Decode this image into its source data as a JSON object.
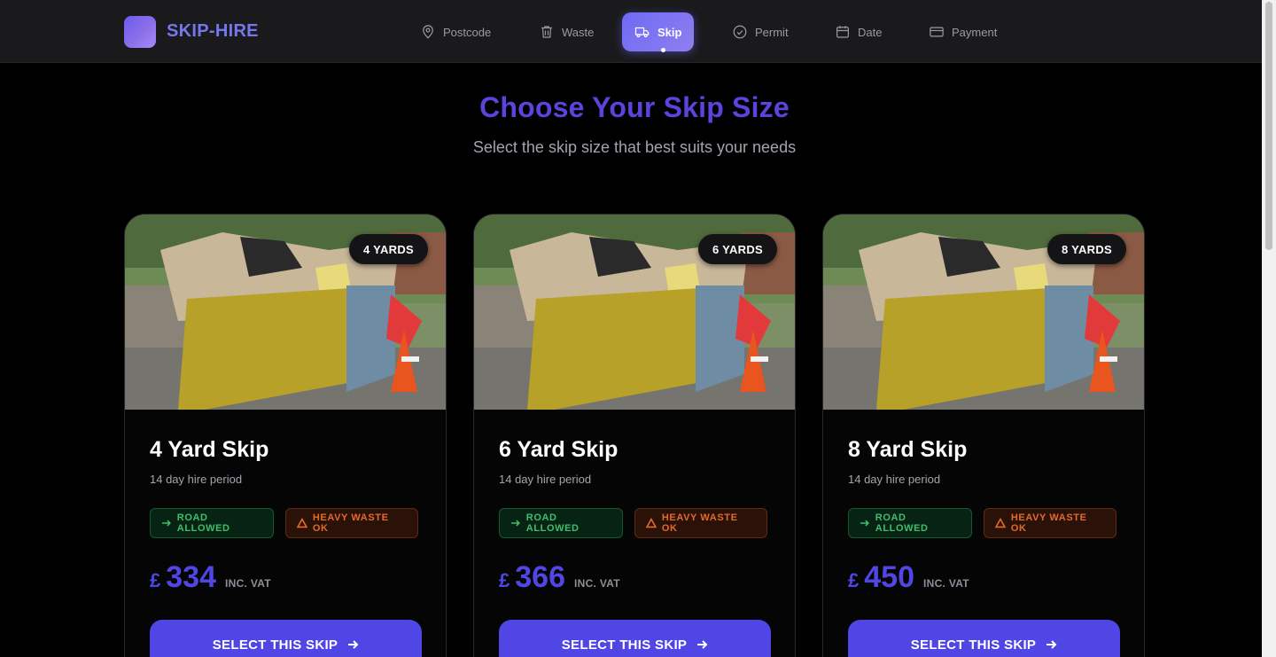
{
  "brand": {
    "name": "SKIP-HIRE"
  },
  "steps": [
    {
      "label": "Postcode",
      "icon": "map-pin-icon",
      "active": false
    },
    {
      "label": "Waste",
      "icon": "trash-icon",
      "active": false
    },
    {
      "label": "Skip",
      "icon": "truck-icon",
      "active": true
    },
    {
      "label": "Permit",
      "icon": "check-circle-icon",
      "active": false
    },
    {
      "label": "Date",
      "icon": "calendar-icon",
      "active": false
    },
    {
      "label": "Payment",
      "icon": "credit-card-icon",
      "active": false
    }
  ],
  "heading": {
    "title": "Choose Your Skip Size",
    "subtitle": "Select the skip size that best suits your needs"
  },
  "skips": [
    {
      "badge": "4 YARDS",
      "title": "4 Yard Skip",
      "period": "14 day hire period",
      "tags": [
        "ROAD ALLOWED",
        "HEAVY WASTE OK"
      ],
      "currency": "£",
      "price": "334",
      "vat": "INC. VAT",
      "button": "SELECT THIS SKIP"
    },
    {
      "badge": "6 YARDS",
      "title": "6 Yard Skip",
      "period": "14 day hire period",
      "tags": [
        "ROAD ALLOWED",
        "HEAVY WASTE OK"
      ],
      "currency": "£",
      "price": "366",
      "vat": "INC. VAT",
      "button": "SELECT THIS SKIP"
    },
    {
      "badge": "8 YARDS",
      "title": "8 Yard Skip",
      "period": "14 day hire period",
      "tags": [
        "ROAD ALLOWED",
        "HEAVY WASTE OK"
      ],
      "currency": "£",
      "price": "450",
      "vat": "INC. VAT",
      "button": "SELECT THIS SKIP"
    }
  ],
  "colors": {
    "accent": "#4f46e5",
    "road_tag": "#3fbf6a",
    "heavy_tag": "#e46a2b",
    "background": "#000000"
  }
}
